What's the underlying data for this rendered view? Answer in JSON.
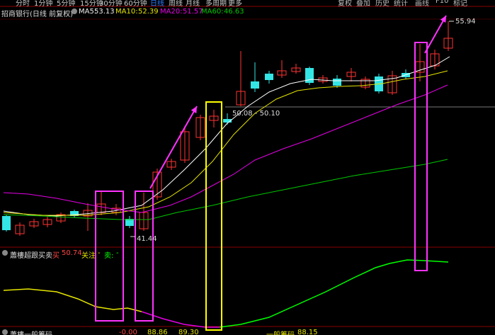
{
  "topbar": {
    "tabs": [
      "分时",
      "1分钟",
      "5分钟",
      "15分钟",
      "30分钟",
      "60分钟",
      "日线",
      "周线",
      "月线",
      "多周期",
      "更多"
    ],
    "active_tab": "日线",
    "right_tabs": [
      "复权",
      "叠加",
      "历史",
      "统计",
      "画线",
      "F10",
      "标记"
    ]
  },
  "stock": {
    "name": "招商银行(日线 前复权)",
    "ma5_label": "MA5:",
    "ma5": "53.13",
    "ma10_label": "MA10:",
    "ma10": "52.39",
    "ma20_label": "MA20:",
    "ma20": "51.57",
    "ma60_label": "MA60:",
    "ma60": "46.63"
  },
  "annotations": {
    "high_price": "55.94",
    "low_price": "41.44",
    "crosshair_range": "50.08 - 50.10"
  },
  "indicator": {
    "title": "蕭樓超跟买卖",
    "buy_label": "买",
    "buy_value": "50.74",
    "watch_label": "关注",
    "watch_value": "-",
    "sell_label": "卖:",
    "sell_value": "-"
  },
  "bottom_indicator": {
    "title": "蕭樓一般筹码",
    "v1": "-0.00",
    "v2": "88.86",
    "v3": "89.30",
    "label_right": "一般筹码",
    "v4": "88.15"
  },
  "colors": {
    "up_candle": "#ff3333",
    "down_candle": "#33e5e5",
    "ma5": "#ffffff",
    "ma10": "#e5e500",
    "ma20": "#e500e5",
    "ma60": "#00c800",
    "box_magenta": "#ff33ff",
    "box_yellow": "#ffff00",
    "indicator_line_yellow": "#e5e500",
    "indicator_line_magenta": "#e500e5",
    "indicator_line_green": "#00ff00"
  }
}
